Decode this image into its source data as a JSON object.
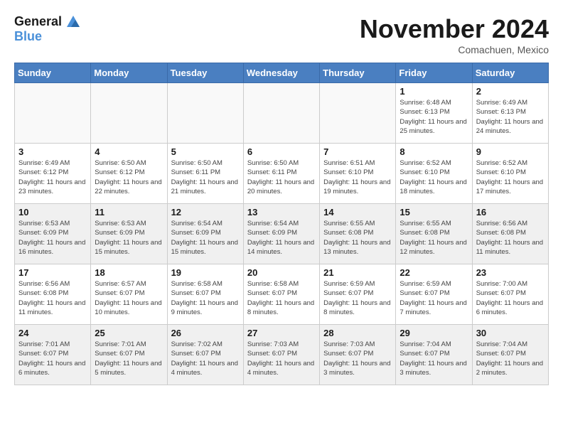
{
  "header": {
    "logo_line1": "General",
    "logo_line2": "Blue",
    "month": "November 2024",
    "location": "Comachuen, Mexico"
  },
  "weekdays": [
    "Sunday",
    "Monday",
    "Tuesday",
    "Wednesday",
    "Thursday",
    "Friday",
    "Saturday"
  ],
  "weeks": [
    [
      {
        "day": "",
        "info": "",
        "empty": true
      },
      {
        "day": "",
        "info": "",
        "empty": true
      },
      {
        "day": "",
        "info": "",
        "empty": true
      },
      {
        "day": "",
        "info": "",
        "empty": true
      },
      {
        "day": "",
        "info": "",
        "empty": true
      },
      {
        "day": "1",
        "info": "Sunrise: 6:48 AM\nSunset: 6:13 PM\nDaylight: 11 hours\nand 25 minutes."
      },
      {
        "day": "2",
        "info": "Sunrise: 6:49 AM\nSunset: 6:13 PM\nDaylight: 11 hours\nand 24 minutes."
      }
    ],
    [
      {
        "day": "3",
        "info": "Sunrise: 6:49 AM\nSunset: 6:12 PM\nDaylight: 11 hours\nand 23 minutes."
      },
      {
        "day": "4",
        "info": "Sunrise: 6:50 AM\nSunset: 6:12 PM\nDaylight: 11 hours\nand 22 minutes."
      },
      {
        "day": "5",
        "info": "Sunrise: 6:50 AM\nSunset: 6:11 PM\nDaylight: 11 hours\nand 21 minutes."
      },
      {
        "day": "6",
        "info": "Sunrise: 6:50 AM\nSunset: 6:11 PM\nDaylight: 11 hours\nand 20 minutes."
      },
      {
        "day": "7",
        "info": "Sunrise: 6:51 AM\nSunset: 6:10 PM\nDaylight: 11 hours\nand 19 minutes."
      },
      {
        "day": "8",
        "info": "Sunrise: 6:52 AM\nSunset: 6:10 PM\nDaylight: 11 hours\nand 18 minutes."
      },
      {
        "day": "9",
        "info": "Sunrise: 6:52 AM\nSunset: 6:10 PM\nDaylight: 11 hours\nand 17 minutes."
      }
    ],
    [
      {
        "day": "10",
        "info": "Sunrise: 6:53 AM\nSunset: 6:09 PM\nDaylight: 11 hours\nand 16 minutes."
      },
      {
        "day": "11",
        "info": "Sunrise: 6:53 AM\nSunset: 6:09 PM\nDaylight: 11 hours\nand 15 minutes."
      },
      {
        "day": "12",
        "info": "Sunrise: 6:54 AM\nSunset: 6:09 PM\nDaylight: 11 hours\nand 15 minutes."
      },
      {
        "day": "13",
        "info": "Sunrise: 6:54 AM\nSunset: 6:09 PM\nDaylight: 11 hours\nand 14 minutes."
      },
      {
        "day": "14",
        "info": "Sunrise: 6:55 AM\nSunset: 6:08 PM\nDaylight: 11 hours\nand 13 minutes."
      },
      {
        "day": "15",
        "info": "Sunrise: 6:55 AM\nSunset: 6:08 PM\nDaylight: 11 hours\nand 12 minutes."
      },
      {
        "day": "16",
        "info": "Sunrise: 6:56 AM\nSunset: 6:08 PM\nDaylight: 11 hours\nand 11 minutes."
      }
    ],
    [
      {
        "day": "17",
        "info": "Sunrise: 6:56 AM\nSunset: 6:08 PM\nDaylight: 11 hours\nand 11 minutes."
      },
      {
        "day": "18",
        "info": "Sunrise: 6:57 AM\nSunset: 6:07 PM\nDaylight: 11 hours\nand 10 minutes."
      },
      {
        "day": "19",
        "info": "Sunrise: 6:58 AM\nSunset: 6:07 PM\nDaylight: 11 hours\nand 9 minutes."
      },
      {
        "day": "20",
        "info": "Sunrise: 6:58 AM\nSunset: 6:07 PM\nDaylight: 11 hours\nand 8 minutes."
      },
      {
        "day": "21",
        "info": "Sunrise: 6:59 AM\nSunset: 6:07 PM\nDaylight: 11 hours\nand 8 minutes."
      },
      {
        "day": "22",
        "info": "Sunrise: 6:59 AM\nSunset: 6:07 PM\nDaylight: 11 hours\nand 7 minutes."
      },
      {
        "day": "23",
        "info": "Sunrise: 7:00 AM\nSunset: 6:07 PM\nDaylight: 11 hours\nand 6 minutes."
      }
    ],
    [
      {
        "day": "24",
        "info": "Sunrise: 7:01 AM\nSunset: 6:07 PM\nDaylight: 11 hours\nand 6 minutes."
      },
      {
        "day": "25",
        "info": "Sunrise: 7:01 AM\nSunset: 6:07 PM\nDaylight: 11 hours\nand 5 minutes."
      },
      {
        "day": "26",
        "info": "Sunrise: 7:02 AM\nSunset: 6:07 PM\nDaylight: 11 hours\nand 4 minutes."
      },
      {
        "day": "27",
        "info": "Sunrise: 7:03 AM\nSunset: 6:07 PM\nDaylight: 11 hours\nand 4 minutes."
      },
      {
        "day": "28",
        "info": "Sunrise: 7:03 AM\nSunset: 6:07 PM\nDaylight: 11 hours\nand 3 minutes."
      },
      {
        "day": "29",
        "info": "Sunrise: 7:04 AM\nSunset: 6:07 PM\nDaylight: 11 hours\nand 3 minutes."
      },
      {
        "day": "30",
        "info": "Sunrise: 7:04 AM\nSunset: 6:07 PM\nDaylight: 11 hours\nand 2 minutes."
      }
    ]
  ]
}
